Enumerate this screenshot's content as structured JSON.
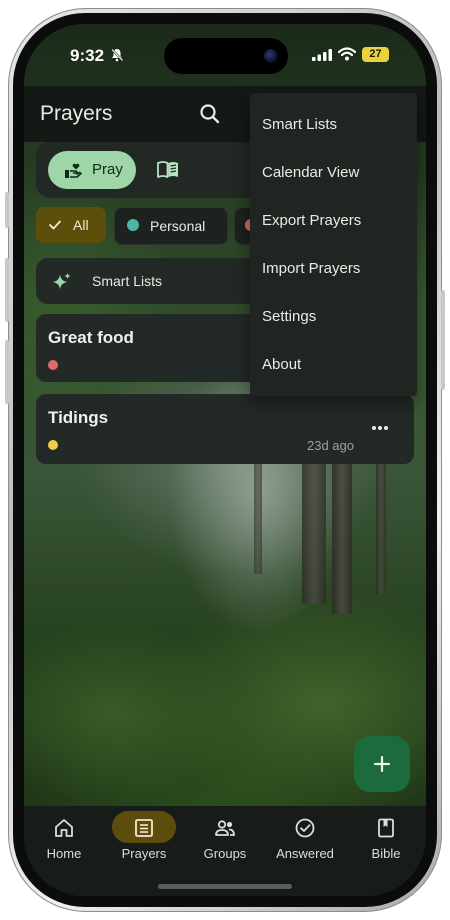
{
  "status_bar": {
    "time": "9:32",
    "battery": "27"
  },
  "app_bar": {
    "title": "Prayers"
  },
  "toolbar": {
    "pray_label": "Pray"
  },
  "filters": {
    "chips": [
      {
        "label": "All",
        "selected": true
      },
      {
        "label": "Personal",
        "color": "#4fb3a8"
      },
      {
        "label": "",
        "color": "#e06a6a"
      }
    ]
  },
  "smart_lists": {
    "label": "Smart Lists"
  },
  "prayers": [
    {
      "title": "Great food",
      "dot_color": "#e06a6a",
      "age": ""
    },
    {
      "title": "Tidings",
      "dot_color": "#f2cc46",
      "age": "23d ago"
    }
  ],
  "overflow_menu": {
    "items": [
      {
        "label": "Smart Lists"
      },
      {
        "label": "Calendar View"
      },
      {
        "label": "Export Prayers"
      },
      {
        "label": "Import Prayers"
      },
      {
        "label": "Settings"
      },
      {
        "label": "About"
      }
    ]
  },
  "bottom_nav": {
    "items": [
      {
        "label": "Home",
        "icon": "home-icon",
        "active": false
      },
      {
        "label": "Prayers",
        "icon": "list-icon",
        "active": true
      },
      {
        "label": "Groups",
        "icon": "groups-icon",
        "active": false
      },
      {
        "label": "Answered",
        "icon": "check-circle-icon",
        "active": false
      },
      {
        "label": "Bible",
        "icon": "bible-icon",
        "active": false
      }
    ]
  },
  "colors": {
    "accent_green": "#9ed6a8",
    "selected_chip": "#5e4e0c",
    "fab": "#1d6a3c",
    "surface": "#1f2520"
  }
}
